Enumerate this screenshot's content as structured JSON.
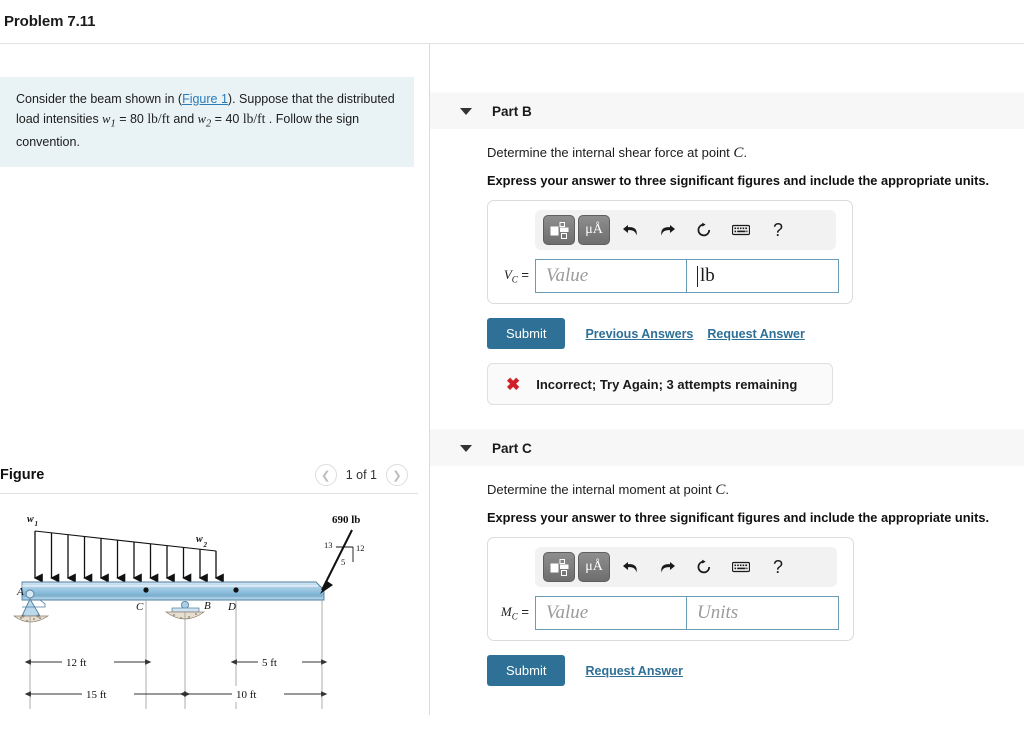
{
  "header": {
    "problem_title": "Problem 7.11"
  },
  "statement": {
    "text_before_link": "Consider the beam shown in (",
    "figure_link": "Figure 1",
    "text_after_link": "). Suppose that the distributed load intensities ",
    "w1_symbol": "w",
    "w1_sub": "1",
    "w1_eq": " = 80 ",
    "w1_units": "lb/ft",
    "and_text": " and ",
    "w2_symbol": "w",
    "w2_sub": "2",
    "w2_eq": " = 40 ",
    "w2_units": "lb/ft",
    "tail": " . Follow the sign convention."
  },
  "figure": {
    "label": "Figure",
    "counter": "1 of 1",
    "prev_icon": "chevron-left-icon",
    "next_icon": "chevron-right-icon",
    "diagram": {
      "w1_label": "w",
      "w1_sub": "1",
      "w2_label": "w",
      "w2_sub": "2",
      "point_a": "A",
      "point_b": "B",
      "point_c": "C",
      "point_d": "D",
      "force_label": "690 lb",
      "triangle_13": "13",
      "triangle_12": "12",
      "triangle_5": "5",
      "dim_12ft": "12 ft",
      "dim_5ft": "5 ft",
      "dim_15ft": "15 ft",
      "dim_10ft": "10 ft",
      "beam_color": "#9dc6e0",
      "beam_edge": "#2c5a78"
    }
  },
  "toolbar": {
    "template_icon": "math-template-icon",
    "symbols_icon": "greek-symbols-icon",
    "symbols_label": "μÅ",
    "undo_icon": "undo-icon",
    "redo_icon": "redo-icon",
    "reset_icon": "reset-icon",
    "keyboard_icon": "keyboard-icon",
    "help_icon": "help-icon",
    "help_label": "?"
  },
  "parts": [
    {
      "id": "part-b",
      "title": "Part B",
      "caret_icon": "caret-down-icon",
      "prompt_prefix": "Determine the internal shear force at point ",
      "prompt_symbol": "C",
      "prompt_suffix": ".",
      "instruction": "Express your answer to three significant figures and include the appropriate units.",
      "field_symbol": "V",
      "field_sub": "C",
      "field_eq": " =",
      "value_placeholder": "Value",
      "units_value": "lb",
      "units_placeholder": "Units",
      "units_filled": true,
      "submit_label": "Submit",
      "links": [
        "Previous Answers",
        "Request Answer"
      ],
      "feedback": {
        "icon": "error-x-icon",
        "text": "Incorrect; Try Again; 3 attempts remaining"
      }
    },
    {
      "id": "part-c",
      "title": "Part C",
      "caret_icon": "caret-down-icon",
      "prompt_prefix": "Determine the internal moment at point ",
      "prompt_symbol": "C",
      "prompt_suffix": ".",
      "instruction": "Express your answer to three significant figures and include the appropriate units.",
      "field_symbol": "M",
      "field_sub": "C",
      "field_eq": " =",
      "value_placeholder": "Value",
      "units_value": "",
      "units_placeholder": "Units",
      "units_filled": false,
      "submit_label": "Submit",
      "links": [
        "Request Answer"
      ],
      "feedback": null
    }
  ],
  "colors": {
    "accent": "#2e7096",
    "statement_bg": "#e9f3f5",
    "link": "#2b7bb9",
    "error": "#cf2027",
    "part_header_bg": "#f7f7f7"
  }
}
